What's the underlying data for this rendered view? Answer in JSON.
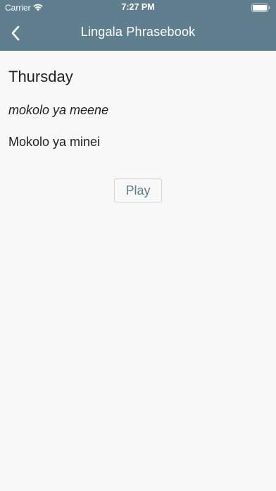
{
  "status_bar": {
    "carrier": "Carrier",
    "time": "7:27 PM",
    "wifi_icon": "wifi-icon",
    "battery_icon": "battery-icon"
  },
  "nav": {
    "back_icon": "chevron-left-icon",
    "title": "Lingala Phrasebook"
  },
  "phrase": {
    "english": "Thursday",
    "lingala": "mokolo ya meene",
    "pronunciation": "Mokolo ya minei"
  },
  "actions": {
    "play_label": "Play"
  },
  "colors": {
    "header_bg": "#5f7f8e",
    "page_bg": "#f8f8f8",
    "text": "#222222",
    "accent": "#5f7f8e"
  }
}
